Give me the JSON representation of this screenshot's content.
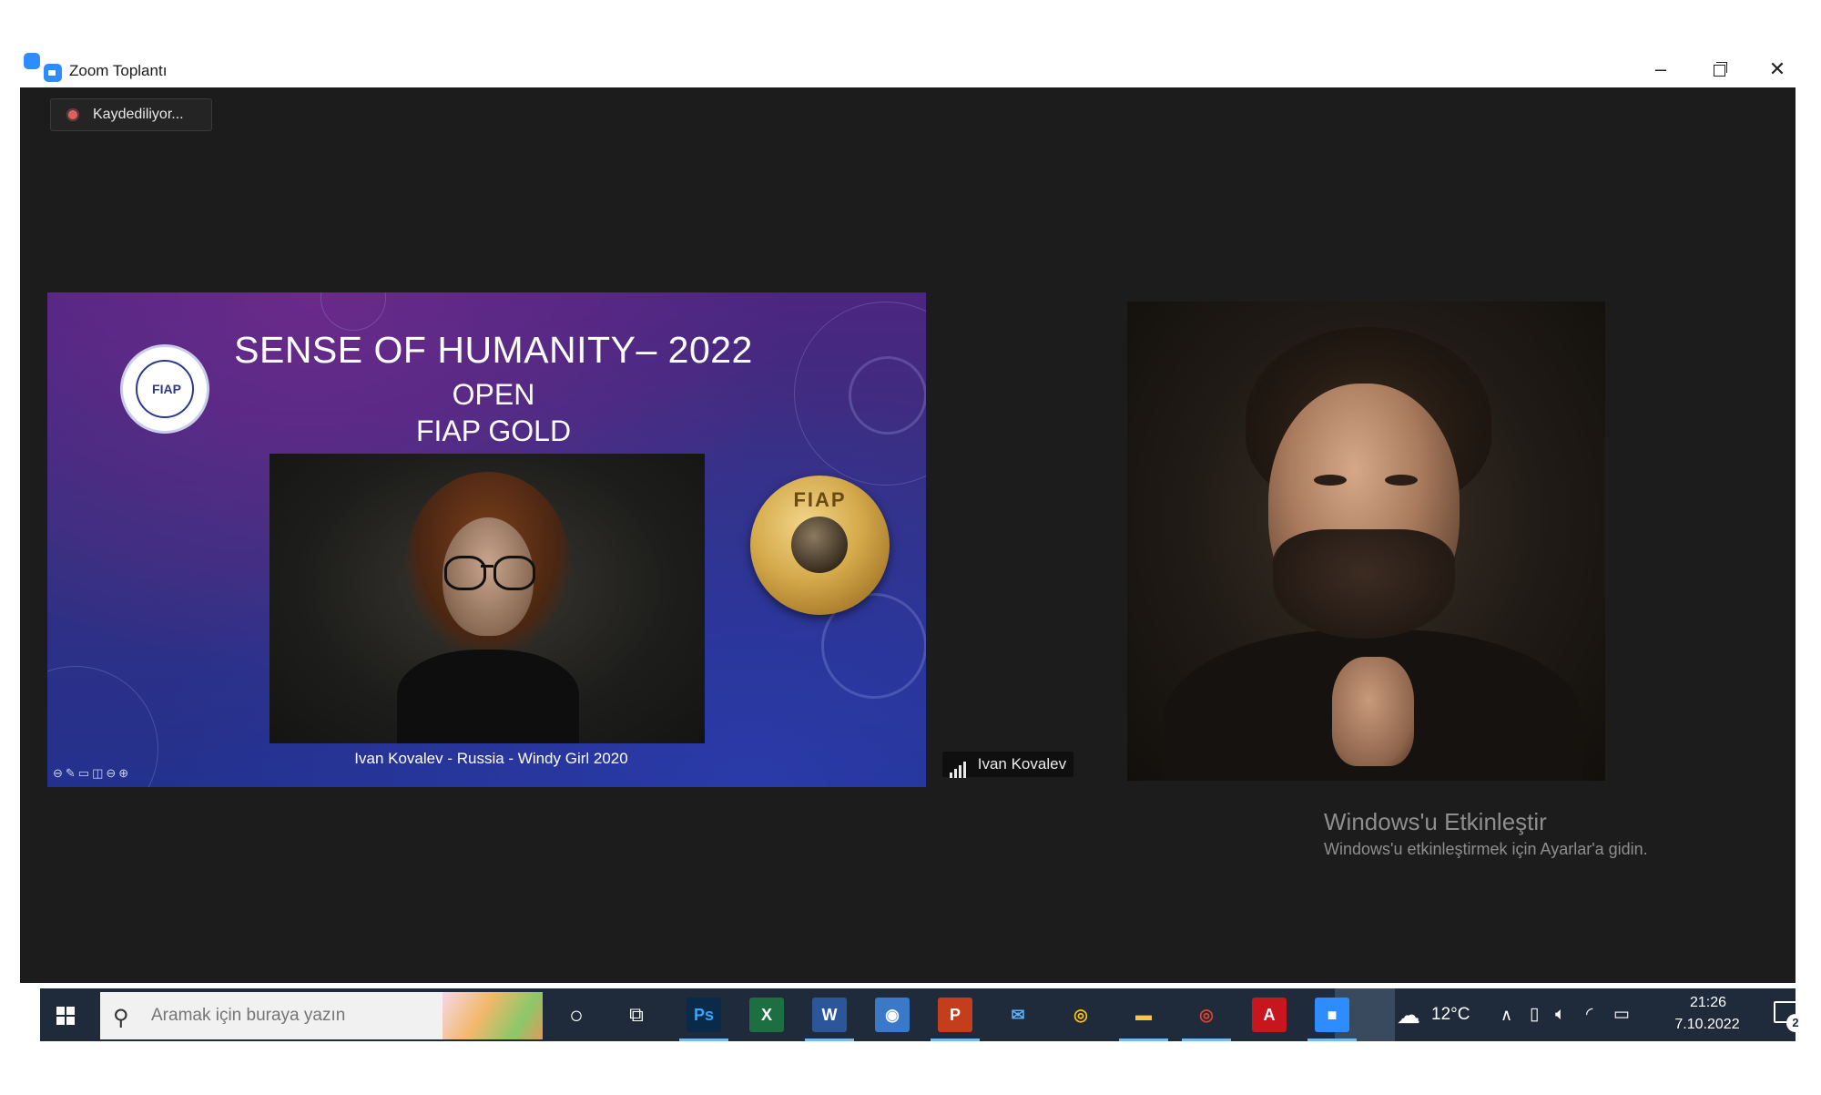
{
  "window": {
    "title": "Zoom Toplantı",
    "minimize": "–",
    "close": "✕"
  },
  "recording": {
    "label": "Kaydediliyor..."
  },
  "slide": {
    "title": "SENSE OF HUMANITY– 2022",
    "subtitle1": "OPEN",
    "subtitle2": "FIAP GOLD",
    "logo_text": "FIAP",
    "medal_text": "FIAP",
    "caption": "Ivan Kovalev - Russia - Windy Girl 2020",
    "tools": "⊖✎▭◫⊖⊕"
  },
  "participant": {
    "name": "Ivan Kovalev"
  },
  "watermark": {
    "title": "Windows'u Etkinleştir",
    "subtitle": "Windows'u etkinleştirmek için Ayarlar'a gidin."
  },
  "taskbar": {
    "search_placeholder": "Aramak için buraya yazın",
    "apps": [
      {
        "name": "photoshop",
        "label": "Ps",
        "color": "#0a2a4a",
        "fg": "#31a8ff"
      },
      {
        "name": "excel",
        "label": "X",
        "color": "#1d6f42",
        "fg": "#ffffff"
      },
      {
        "name": "word",
        "label": "W",
        "color": "#2b579a",
        "fg": "#ffffff"
      },
      {
        "name": "network",
        "label": "◉",
        "color": "#3a78c8",
        "fg": "#ffffff"
      },
      {
        "name": "powerpoint",
        "label": "P",
        "color": "#c43e1c",
        "fg": "#ffffff"
      },
      {
        "name": "mail",
        "label": "✉",
        "color": "#1f2a3a",
        "fg": "#5ab0f0"
      },
      {
        "name": "chrome",
        "label": "◎",
        "color": "#1f2a3a",
        "fg": "#f4c20d"
      },
      {
        "name": "file-explorer",
        "label": "▬",
        "color": "#1f2a3a",
        "fg": "#f6c74a"
      },
      {
        "name": "chrome-profile",
        "label": "◎",
        "color": "#1f2a3a",
        "fg": "#db4437"
      },
      {
        "name": "acrobat",
        "label": "A",
        "color": "#c7161d",
        "fg": "#ffffff"
      },
      {
        "name": "zoom",
        "label": "■",
        "color": "#2d8cff",
        "fg": "#ffffff"
      }
    ],
    "weather": "12°C",
    "time": "21:26",
    "date": "7.10.2022",
    "notification_count": "2"
  }
}
